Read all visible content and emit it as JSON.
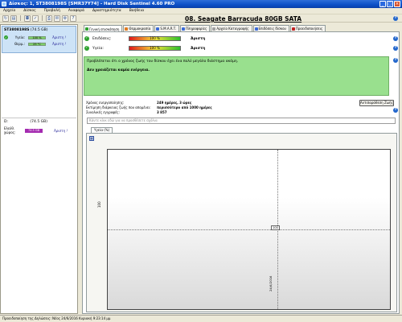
{
  "window": {
    "title": "Δίσκος: 1, ST3808198S [SMR37Y74] - Hard Disk Sentinel 4.60 PRO"
  },
  "menu": [
    "Αρχείο",
    "Δίσκος",
    "Προβολή",
    "Αναφορά",
    "Δραστηριότητα",
    "Βοήθεια"
  ],
  "toolbar": {
    "icons": [
      "refresh-icon",
      "report-icon",
      "disk-icon",
      "test-icon",
      "print-icon",
      "send-icon",
      "options-icon",
      "help-icon"
    ]
  },
  "left": {
    "disk": {
      "name": "ST3808198S",
      "size": "(74.5 GB)",
      "health_label": "Υγεία:",
      "health_value": "100 %",
      "health_status": "Άριστη !",
      "temp_label": "Θερμ.:",
      "temp_value": "25 °C",
      "temp_status": "Άριστη !"
    },
    "volume": {
      "name": "D:",
      "size": "(74.5 GB)",
      "free_label": "Ελεύθ. χώρος:",
      "free_value": "74.5 GB",
      "free_status": "Άριστη !",
      "free_fraction": 1.0
    }
  },
  "main": {
    "disk_title": "08. Seagate Barracuda 80GB SATA",
    "tabs": [
      {
        "label": "Γενική επισκόπηση",
        "icon": "overview-icon",
        "color": "#2ea12e"
      },
      {
        "label": "Θερμοκρασία",
        "icon": "temperature-icon",
        "color": "#e07a20"
      },
      {
        "label": "S.M.A.R.T.",
        "icon": "smart-icon",
        "color": "#3a6ad8"
      },
      {
        "label": "Πληροφορίες",
        "icon": "info-icon",
        "color": "#3a6ad8"
      },
      {
        "label": "Αρχείο Καταγραφής",
        "icon": "log-icon",
        "color": "#a0a0a0"
      },
      {
        "label": "Επιδόσεις δίσκου",
        "icon": "performance-icon",
        "color": "#3a6ad8"
      },
      {
        "label": "Προειδοποιήσεις",
        "icon": "alerts-icon",
        "color": "#c02020"
      }
    ],
    "performance": {
      "label": "Επιδόσεις:",
      "value": "100 %",
      "word": "Άριστη",
      "level": 1.0
    },
    "health": {
      "label": "Υγεία:",
      "value": "100 %",
      "word": "Άριστη",
      "level": 1.0
    },
    "message_line1": "Προβλέπεται ότι ο χρόνος ζωής του δίσκου έχει ένα πολύ μεγάλο διάστημα ακόμη.",
    "message_line2": "Δεν χρειάζεται καμία ενέργεια.",
    "info": [
      {
        "key": "Χρόνος ενεργοποίησης:",
        "value": "249 ημέρες, 3 ώρες"
      },
      {
        "key": "Εκτίμηση διάρκειας ζωής που απομένει:",
        "value": "περισσότερο από 1000 ημέρες"
      },
      {
        "key": "Συνολικές εγγραφές:",
        "value": "3 857"
      }
    ],
    "dates_button": "Αντιπαράθεση Ζωής",
    "notes_placeholder": "Κάντε κλικ εδώ για να προσθέσετε σχόλια",
    "subtab": "Υγεία (%)",
    "chart_data": {
      "type": "line",
      "title": "",
      "xlabel": "",
      "ylabel": "100",
      "x": [
        "24/6/2016"
      ],
      "series": [
        {
          "values": [
            100
          ]
        }
      ],
      "grid": true,
      "point_label": "100"
    }
  },
  "statusbar": {
    "text": "Προειδοποίηση της Δηλώσεις: Νέος 24/6/2016 Κυριακή 9:23:14 μμ"
  }
}
